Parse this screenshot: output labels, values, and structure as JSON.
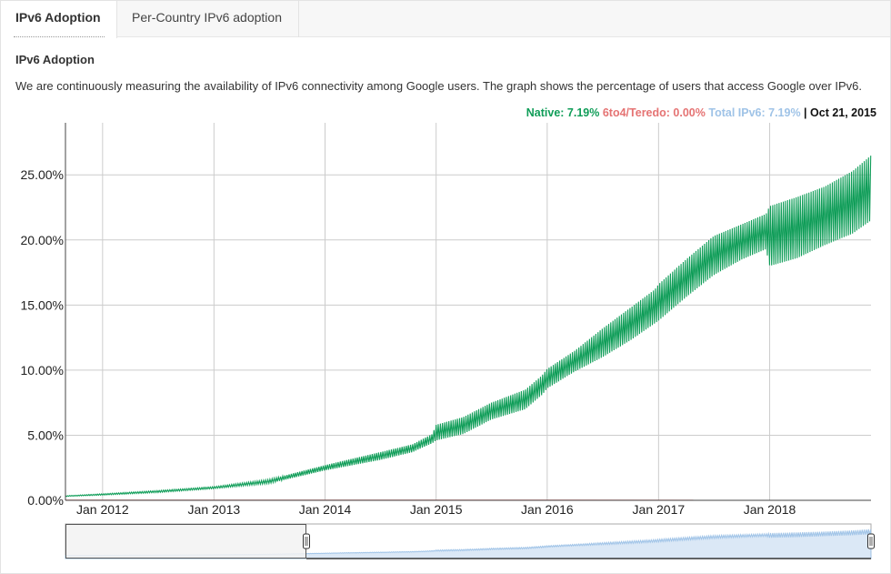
{
  "tabs": [
    {
      "label": "IPv6 Adoption",
      "active": true
    },
    {
      "label": "Per-Country IPv6 adoption",
      "active": false
    }
  ],
  "heading": "IPv6 Adoption",
  "description": "We are continuously measuring the availability of IPv6 connectivity among Google users. The graph shows the percentage of users that access Google over IPv6.",
  "legend": {
    "native": "Native: 7.19%",
    "teredo": "6to4/Teredo: 0.00%",
    "total": "Total IPv6: 7.19%",
    "date": "| Oct 21, 2015"
  },
  "colors": {
    "native": "#0f9d58",
    "teredo": "#e57373",
    "total": "#9fc3e7"
  },
  "chart_data": {
    "type": "line",
    "x_range": [
      "2011-09-01",
      "2018-11-30"
    ],
    "ylim": [
      0,
      29
    ],
    "y_ticks": [
      "0.00%",
      "5.00%",
      "10.00%",
      "15.00%",
      "20.00%",
      "25.00%"
    ],
    "x_ticks": [
      "Jan 2012",
      "Jan 2013",
      "Jan 2014",
      "Jan 2015",
      "Jan 2016",
      "Jan 2017",
      "Jan 2018"
    ],
    "grid": true,
    "series": [
      {
        "name": "Native",
        "x": [
          "2011-09-01",
          "2012-01-01",
          "2012-07-01",
          "2013-01-01",
          "2013-07-01",
          "2014-01-01",
          "2014-07-01",
          "2014-10-15",
          "2014-12-20",
          "2015-01-01",
          "2015-04-01",
          "2015-07-01",
          "2015-10-21",
          "2015-12-15",
          "2016-01-01",
          "2016-04-01",
          "2016-07-01",
          "2016-10-01",
          "2016-12-20",
          "2017-01-01",
          "2017-04-01",
          "2017-07-01",
          "2017-10-01",
          "2017-12-20",
          "2018-01-01",
          "2018-04-01",
          "2018-07-01",
          "2018-10-01",
          "2018-11-30"
        ],
        "min": [
          0.3,
          0.4,
          0.6,
          0.9,
          1.3,
          2.3,
          3.1,
          3.7,
          4.4,
          4.6,
          5.1,
          6.2,
          7.0,
          8.1,
          8.6,
          9.9,
          11.0,
          12.3,
          13.6,
          13.8,
          15.6,
          17.3,
          18.5,
          19.3,
          18.0,
          18.6,
          19.6,
          20.5,
          21.5
        ],
        "max": [
          0.35,
          0.5,
          0.75,
          1.05,
          1.6,
          2.7,
          3.7,
          4.3,
          5.1,
          5.8,
          6.4,
          7.5,
          8.5,
          9.6,
          10.1,
          11.5,
          13.2,
          14.8,
          16.2,
          16.6,
          18.5,
          20.3,
          21.2,
          22.0,
          22.6,
          23.3,
          24.1,
          25.3,
          26.5
        ]
      },
      {
        "name": "6to4/Teredo",
        "x": [
          "2011-09-01",
          "2018-11-30"
        ],
        "values": [
          0.02,
          0.01
        ]
      }
    ]
  }
}
